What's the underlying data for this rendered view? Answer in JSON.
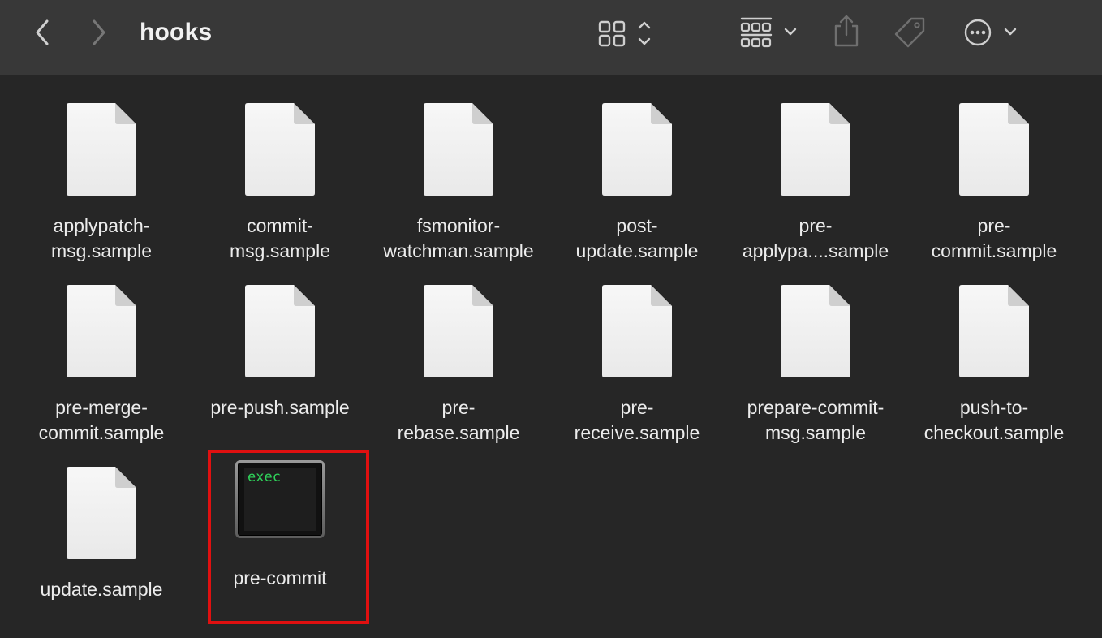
{
  "toolbar": {
    "title": "hooks",
    "icons": {
      "back": "chevron-left-icon",
      "forward": "chevron-right-icon",
      "view": "icon-grid-view-icon",
      "group": "group-by-icon",
      "share": "share-icon",
      "tag": "tag-icon",
      "more": "ellipsis-circle-icon"
    }
  },
  "files": [
    {
      "name": "applypatch-\nmsg.sample",
      "kind": "document"
    },
    {
      "name": "commit-\nmsg.sample",
      "kind": "document"
    },
    {
      "name": "fsmonitor-\nwatchman.sample",
      "kind": "document"
    },
    {
      "name": "post-\nupdate.sample",
      "kind": "document"
    },
    {
      "name": "pre-\napplypa....sample",
      "kind": "document"
    },
    {
      "name": "pre-\ncommit.sample",
      "kind": "document"
    },
    {
      "name": "pre-merge-\ncommit.sample",
      "kind": "document"
    },
    {
      "name": "pre-push.sample",
      "kind": "document"
    },
    {
      "name": "pre-\nrebase.sample",
      "kind": "document"
    },
    {
      "name": "pre-\nreceive.sample",
      "kind": "document"
    },
    {
      "name": "prepare-commit-\nmsg.sample",
      "kind": "document"
    },
    {
      "name": "push-to-\ncheckout.sample",
      "kind": "document"
    },
    {
      "name": "update.sample",
      "kind": "document"
    },
    {
      "name": "pre-commit",
      "kind": "executable",
      "icon_text": "exec",
      "selected": true
    }
  ],
  "colors": {
    "background": "#262626",
    "toolbar": "#383838",
    "selection_outline": "#e01010",
    "exec_text": "#2fd35a"
  }
}
